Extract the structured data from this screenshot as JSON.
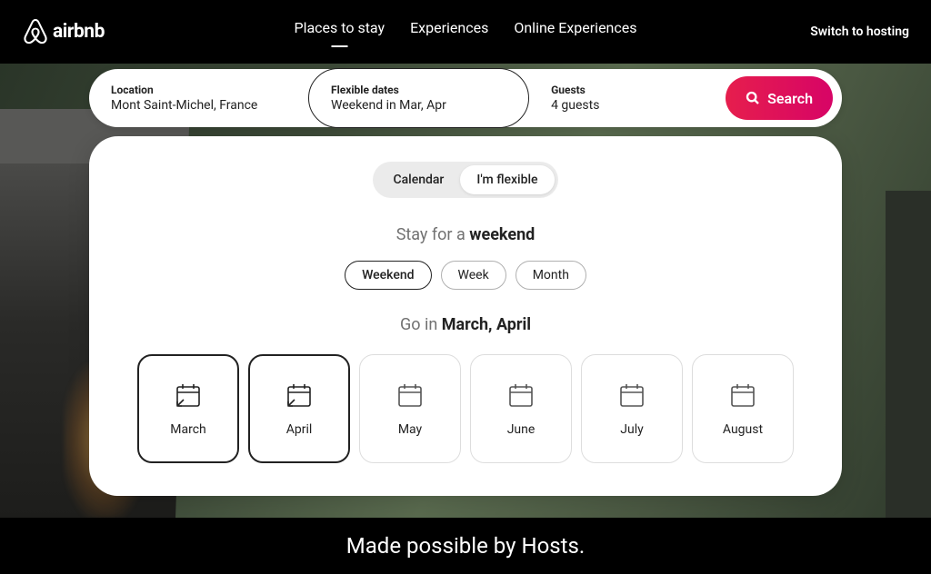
{
  "brand": "airbnb",
  "nav": {
    "tabs": [
      {
        "label": "Places to stay",
        "active": true
      },
      {
        "label": "Experiences",
        "active": false
      },
      {
        "label": "Online Experiences",
        "active": false
      }
    ],
    "hosting": "Switch to hosting"
  },
  "search": {
    "location": {
      "label": "Location",
      "value": "Mont Saint-Michel, France"
    },
    "dates": {
      "label": "Flexible dates",
      "value": "Weekend in Mar, Apr"
    },
    "guests": {
      "label": "Guests",
      "value": "4 guests"
    },
    "button": "Search"
  },
  "flex": {
    "toggle": {
      "calendar": "Calendar",
      "flexible": "I'm flexible",
      "active": "flexible"
    },
    "stay_prefix": "Stay for a ",
    "stay_value": "weekend",
    "durations": [
      {
        "label": "Weekend",
        "selected": true
      },
      {
        "label": "Week",
        "selected": false
      },
      {
        "label": "Month",
        "selected": false
      }
    ],
    "go_prefix": "Go in ",
    "go_value": "March, April",
    "months": [
      {
        "label": "March",
        "selected": true
      },
      {
        "label": "April",
        "selected": true
      },
      {
        "label": "May",
        "selected": false
      },
      {
        "label": "June",
        "selected": false
      },
      {
        "label": "July",
        "selected": false
      },
      {
        "label": "August",
        "selected": false
      }
    ]
  },
  "tagline": "Made possible by Hosts."
}
